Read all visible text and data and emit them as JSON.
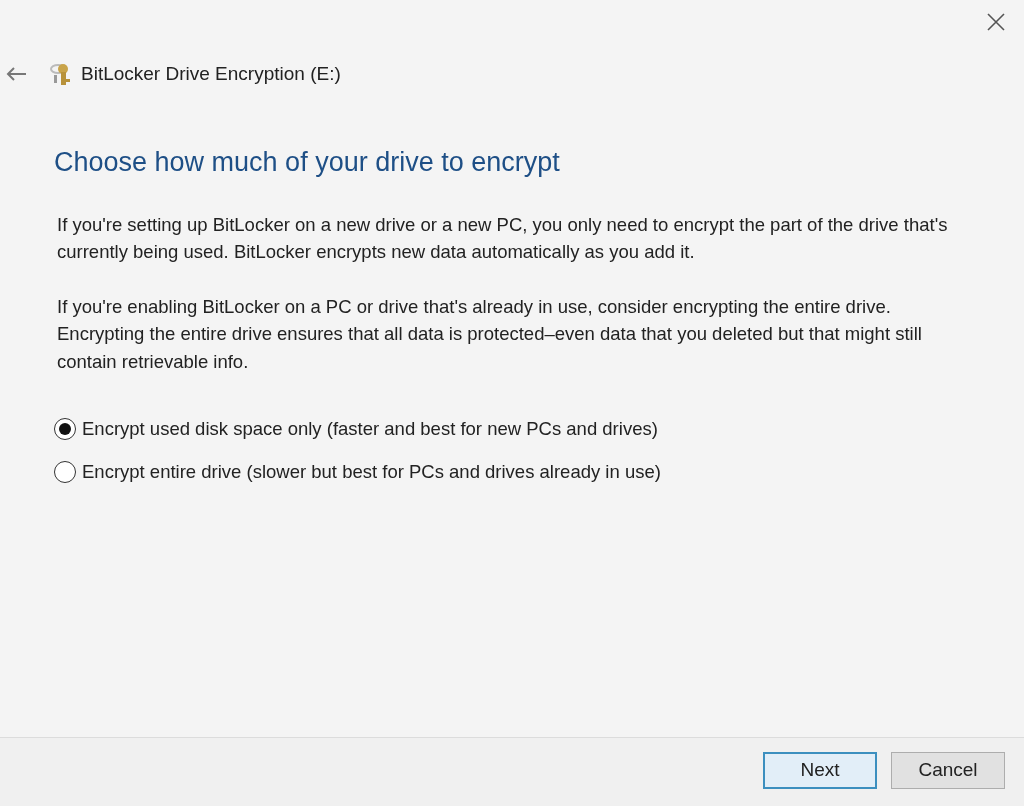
{
  "window": {
    "title": "BitLocker Drive Encryption (E:)"
  },
  "heading": "Choose how much of your drive to encrypt",
  "paragraphs": [
    "If you're setting up BitLocker on a new drive or a new PC, you only need to encrypt the part of the drive that's currently being used. BitLocker encrypts new data automatically as you add it.",
    "If you're enabling BitLocker on a PC or drive that's already in use, consider encrypting the entire drive. Encrypting the entire drive ensures that all data is protected–even data that you deleted but that might still contain retrievable info."
  ],
  "options": [
    {
      "label": "Encrypt used disk space only (faster and best for new PCs and drives)",
      "selected": true
    },
    {
      "label": "Encrypt entire drive (slower but best for PCs and drives already in use)",
      "selected": false
    }
  ],
  "buttons": [
    {
      "label": "Next",
      "kind": "primary"
    },
    {
      "label": "Cancel",
      "kind": "secondary"
    }
  ]
}
